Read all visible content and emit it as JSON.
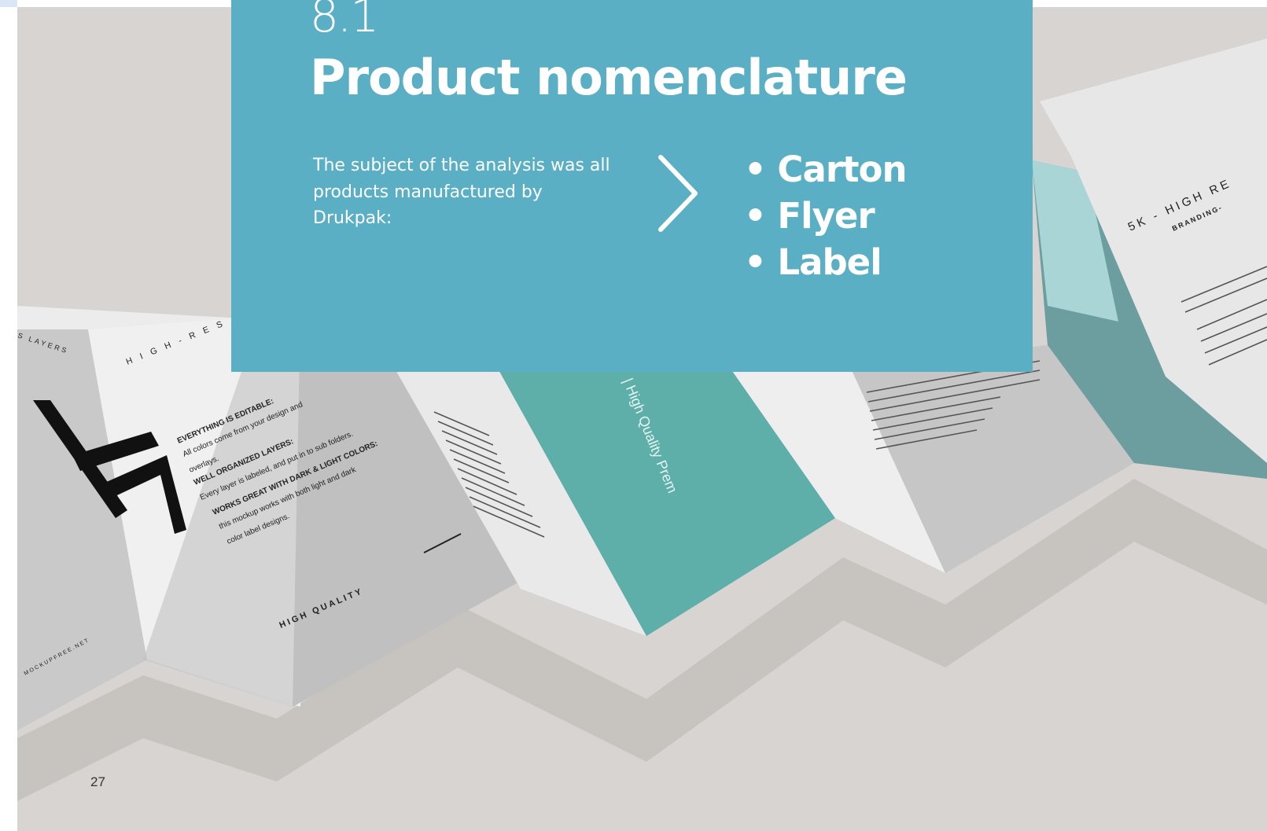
{
  "section": {
    "number": "8.1",
    "title": "Product nomenclature",
    "intro": "The subject of the analysis was all products manufactured by Drukpak:",
    "items": [
      "• Carton",
      "• Flyer",
      "• Label"
    ]
  },
  "page_number": "27",
  "mockup_photo": {
    "texts": {
      "layers": "S LAYERS",
      "high_res_left": "H I G H - R E S",
      "editable_heading": "EVERYTHING IS EDITABLE:",
      "editable_body_1": "All colors come from your design and",
      "editable_body_2": "overlays.",
      "organized_heading": "WELL ORGANIZED LAYERS:",
      "organized_body": "Every layer is labeled, and put in to sub folders.",
      "works_heading": "WORKS GREAT WITH DARK & LIGHT COLORS:",
      "works_body_1": "this mockup works with both light and dark",
      "works_body_2": "color label designs.",
      "high_quality": "HIGH QUALITY",
      "website": "MOCKUPFREE.NET",
      "teal_text": "| High Quality Prem",
      "high_res_right": "5K - HIGH RE",
      "branding": "BRANDING-"
    },
    "colors": {
      "background": "#d7d4d1",
      "paper": "#efefef",
      "paper_shade": "#c8c8c8",
      "teal": "#5eaeaa",
      "panel": "#5aafc5"
    }
  }
}
